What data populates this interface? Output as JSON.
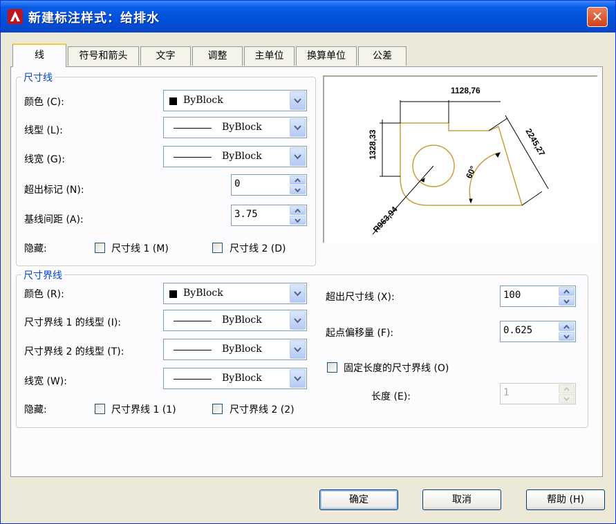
{
  "window": {
    "title": "新建标注样式：给排水",
    "accent": "#0050d8"
  },
  "tabs": [
    {
      "label": "线",
      "active": true
    },
    {
      "label": "符号和箭头"
    },
    {
      "label": "文字"
    },
    {
      "label": "调整"
    },
    {
      "label": "主单位"
    },
    {
      "label": "换算单位"
    },
    {
      "label": "公差"
    }
  ],
  "dimline": {
    "title": "尺寸线",
    "color_label": "颜色 (C):",
    "color_value": "ByBlock",
    "linetype_label": "线型 (L):",
    "linetype_value": "ByBlock",
    "lineweight_label": "线宽 (G):",
    "lineweight_value": "ByBlock",
    "extend_ticks_label": "超出标记 (N):",
    "extend_ticks_value": "0",
    "baseline_spacing_label": "基线间距 (A):",
    "baseline_spacing_value": "3.75",
    "suppress_label": "隐藏:",
    "suppress1": "尺寸线 1 (M)",
    "suppress2": "尺寸线 2 (D)"
  },
  "extline": {
    "title": "尺寸界线",
    "color_label": "颜色 (R):",
    "color_value": "ByBlock",
    "lt1_label": "尺寸界线 1 的线型 (I):",
    "lt1_value": "ByBlock",
    "lt2_label": "尺寸界线 2 的线型 (T):",
    "lt2_value": "ByBlock",
    "lineweight_label": "线宽 (W):",
    "lineweight_value": "ByBlock",
    "suppress_label": "隐藏:",
    "suppress1": "尺寸界线 1 (1)",
    "suppress2": "尺寸界线 2 (2)",
    "extend_label": "超出尺寸线 (X):",
    "extend_value": "100",
    "offset_label": "起点偏移量 (F):",
    "offset_value": "0.625",
    "fixed_label": "固定长度的尺寸界线 (O)",
    "length_label": "长度 (E):",
    "length_value": "1"
  },
  "preview": {
    "dim_top": "1128,76",
    "dim_left": "1328,33",
    "dim_right": "2245,27",
    "dim_angle": "60°",
    "dim_radius": "R963,94",
    "color": "#c8a040"
  },
  "buttons": {
    "ok": "确定",
    "cancel": "取消",
    "help": "帮助 (H)"
  }
}
